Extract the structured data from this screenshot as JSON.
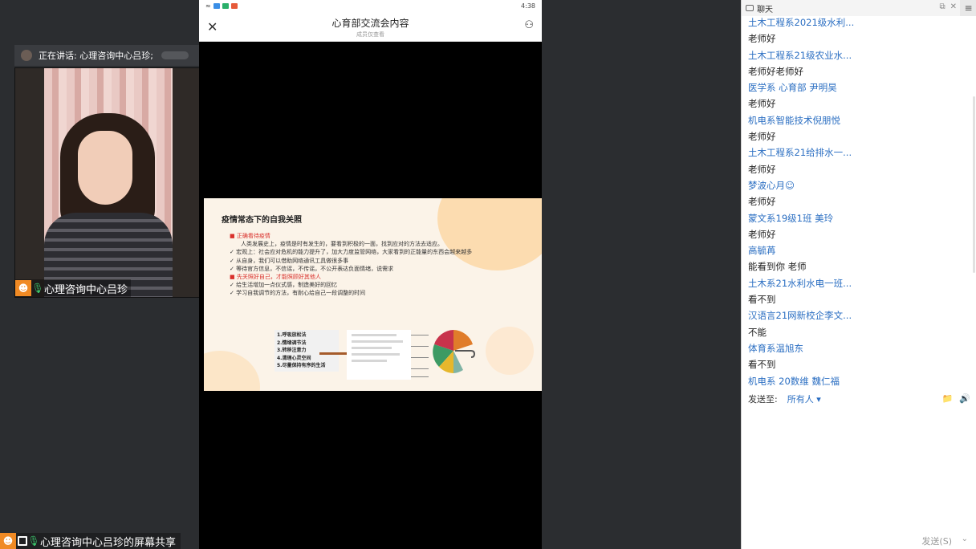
{
  "speaking": {
    "text": "正在讲话: 心理咨询中心吕珍;"
  },
  "collapse_icon": "›",
  "video": {
    "name": "心理咨询中心吕珍"
  },
  "share": {
    "name": "心理咨询中心吕珍的屏幕共享"
  },
  "phone": {
    "status_time": "4:38",
    "title": "心育部交流会内容",
    "subtitle": "成员仅查看",
    "close_glyph": "✕",
    "person_glyph": "⚇"
  },
  "slide": {
    "title": "疫情常态下的自我关照",
    "bullets": [
      {
        "text": "■ 正确看待疫情",
        "red": true,
        "indent": false
      },
      {
        "text": "人类发展史上，疫情是时有发生的，要看到积极的一面，找到应对的方法去适应。",
        "red": false,
        "indent": true
      },
      {
        "text": "✓ 宏观上：社会应对危机的能力提升了，加大力度监管网络，大家看到的正能量的东西会越来越多",
        "red": false,
        "indent": false
      },
      {
        "text": "✓ 从自身，我们可以借助网络通讯工具做很多事",
        "red": false,
        "indent": false
      },
      {
        "text": "✓ 等待官方信息，不信谣，不传谣，不公开表达负面情绪，说需求",
        "red": false,
        "indent": false
      },
      {
        "text": "■ 先关照好自己，才能照顾好其他人",
        "red": true,
        "indent": false
      },
      {
        "text": "✓ 给生活增加一点仪式感，制造美好的回忆",
        "red": false,
        "indent": false
      },
      {
        "text": "✓ 学习自我调节的方法，有耐心给自己一段调整的时间",
        "red": false,
        "indent": false
      }
    ],
    "methods": [
      "1.呼吸放松法",
      "2.情绪调节法",
      "3.转移注意力",
      "4.清理心灵空间",
      "5.尽量保持有序的生活"
    ]
  },
  "chat": {
    "title": "聊天",
    "menu_glyph": "≡",
    "messages": [
      {
        "sender": "土木工程系2021级水利...",
        "text": "老师好"
      },
      {
        "sender": "土木工程系21级农业水...",
        "text": "老师好老师好"
      },
      {
        "sender": "医学系 心育部 尹明昊",
        "text": "老师好"
      },
      {
        "sender": "机电系智能技术倪朋悦",
        "text": "老师好"
      },
      {
        "sender": "土木工程系21给排水一...",
        "text": "老师好"
      },
      {
        "sender": "梦波心月☺",
        "text": "老师好"
      },
      {
        "sender": "蒙文系19级1班  美玲",
        "text": "老师好"
      },
      {
        "sender": "高毓苒",
        "text": "能看到你 老师"
      },
      {
        "sender": "土木系21水利水电一班...",
        "text": "看不到"
      },
      {
        "sender": "汉语言21网新校企李文...",
        "text": "不能"
      },
      {
        "sender": "体育系温旭东",
        "text": "看不到"
      },
      {
        "sender": "机电系 20数维 魏仁福",
        "text": ""
      }
    ],
    "send_to_label": "发送至:",
    "send_to_target": "所有人 ▾",
    "send_button": "发送(S)",
    "send_more": "⌄"
  }
}
